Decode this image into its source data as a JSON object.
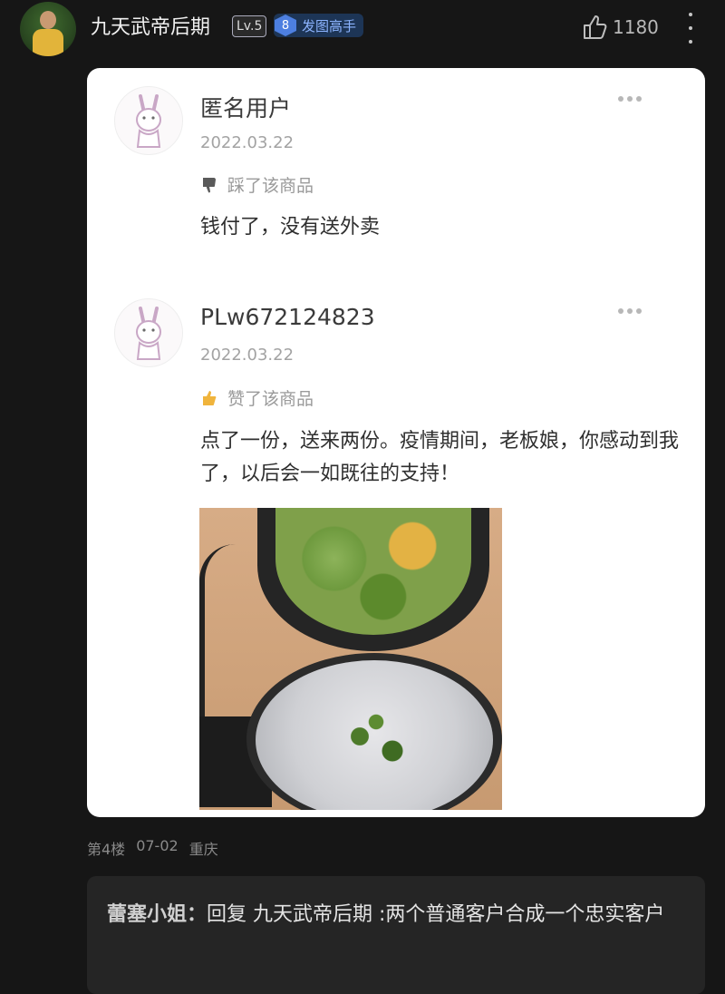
{
  "header": {
    "username": "九天武帝后期",
    "level": "Lv.5",
    "title_badge_num": "8",
    "title_badge_text": "发图高手",
    "like_count": "1180"
  },
  "reviews": [
    {
      "name": "匿名用户",
      "date": "2022.03.22",
      "action": "踩了该商品",
      "text": "钱付了，没有送外卖"
    },
    {
      "name": "PLw672124823",
      "date": "2022.03.22",
      "action": "赞了该商品",
      "text": "点了一份，送来两份。疫情期间，老板娘，你感动到我了，以后会一如既往的支持！"
    }
  ],
  "floor": {
    "floor_no": "第4楼",
    "date": "07-02",
    "location": "重庆"
  },
  "reply": {
    "author": "蕾塞小姐：",
    "text": "回复 九天武帝后期 :两个普通客户合成一个忠实客户"
  },
  "colors": {
    "background": "#161616",
    "card": "#ffffff",
    "badge_blue": "#4d7fe0"
  }
}
